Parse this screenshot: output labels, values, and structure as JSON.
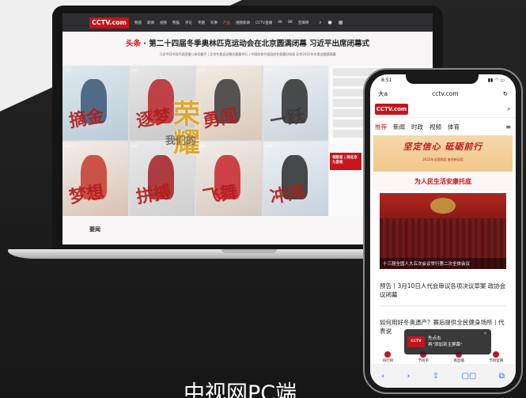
{
  "pc": {
    "logo": "CCTV.com",
    "nav": [
      "频道",
      "新闻",
      "视频",
      "熊猫",
      "评论",
      "专题",
      "军事",
      "产品",
      "视频新闻",
      "CCTV直播",
      "4K",
      "8K",
      "无障碍"
    ],
    "headline_tag": "头条",
    "headline": "第二十四届冬季奥林匹克运动会在北京圆满闭幕 习近平出席闭幕式",
    "subline": "习近平同中国代表团健儿亲切握手 | 北京冬奥会闭幕式隆重举行 | 中国体育代表团创冬奥最好成绩 北京2022年冬奥会圆满落幕",
    "posters": [
      "摘金",
      "逐梦",
      "勇闯",
      "一跃",
      "梦想",
      "拼搏",
      "飞舞",
      "冲鸿"
    ],
    "rongyao": "荣耀",
    "rongyao_small": "我们的",
    "side_red": "领航者 | 闻北京九宫格",
    "section": "要闻"
  },
  "phone": {
    "time": "8:51",
    "url_left": "大a",
    "url": "cctv.com",
    "logo": "CCTV.com",
    "tabs": [
      "推荐",
      "新闻",
      "时政",
      "视频",
      "体育"
    ],
    "banner_title": "坚定信心 砥砺前行",
    "banner_sub": "2022年全国两会 奋进新征程",
    "slogan": "为人民生活安康托底",
    "photo_caption": "十三届全国人大五次会议举行第二次全体会议",
    "news1": "预告丨3月10日人代会审议各项决议草案 政协会议闭幕",
    "news2": "如何用好冬奥遗产？赛后提供全民健身场所丨代表说",
    "popup_line1": "先点击",
    "popup_line2": "再\"添加到主屏幕\"",
    "footer": [
      "排行榜",
      "节目单",
      "看直播",
      "节目官网"
    ],
    "toolbar": [
      "‹",
      "›",
      "⇪",
      "▢▢",
      "⧉"
    ]
  },
  "caption": "中视网PC端"
}
